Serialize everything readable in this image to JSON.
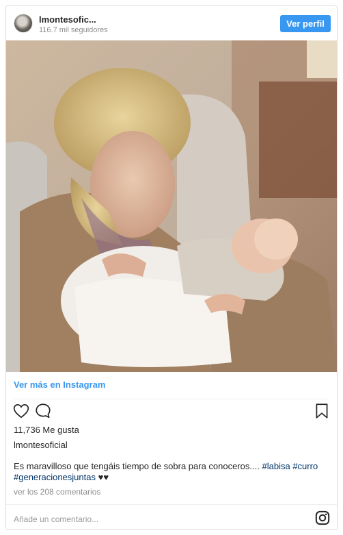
{
  "header": {
    "username": "lmontesofic...",
    "followers": "116.7 mil seguidores",
    "view_profile_label": "Ver perfil"
  },
  "post": {
    "photo_icon": "photo-grandmother-baby",
    "view_more_label": "Ver más en Instagram",
    "likes": "11,736 Me gusta",
    "username": "lmontesoficial",
    "caption_text": "Es maravilloso que tengáis tiempo de sobra para conoceros....",
    "hashtags": [
      "#labisa",
      "#curro",
      "#generacionesjuntas"
    ],
    "caption_emoji": "♥♥",
    "comments_link": "ver los 208 comentarios",
    "comment_placeholder": "Añade un comentario..."
  },
  "icons": {
    "like": "heart-outline-icon",
    "comment": "comment-bubble-icon",
    "save": "bookmark-icon",
    "brand": "instagram-logo-icon"
  },
  "colors": {
    "accent": "#3897f0",
    "hashtag": "#003569",
    "muted": "#8e8e8e",
    "text": "#262626"
  }
}
